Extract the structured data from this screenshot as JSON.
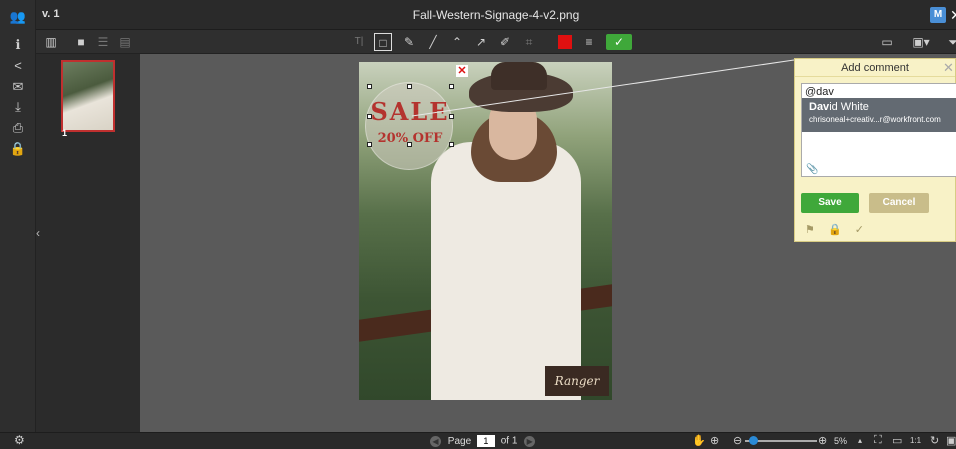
{
  "app": {
    "version": "v. 1",
    "filename": "Fall-Western-Signage-4-v2.png",
    "user_initial": "M"
  },
  "left_rail": [
    {
      "name": "users-icon",
      "glyph": "👥"
    },
    {
      "name": "info-icon",
      "glyph": "ℹ"
    },
    {
      "name": "share-icon",
      "glyph": "<"
    },
    {
      "name": "send-icon",
      "glyph": "✉"
    },
    {
      "name": "download-icon",
      "glyph": "⤓"
    },
    {
      "name": "print-icon",
      "glyph": "⎙"
    },
    {
      "name": "lock-icon",
      "glyph": "🔒"
    }
  ],
  "toolbar": {
    "text_tool": "T|",
    "color_accent": "#e01010",
    "confirm_color": "#3fa83a"
  },
  "thumbnails": [
    {
      "page": "1"
    }
  ],
  "image": {
    "sale_line1": "SALE",
    "sale_line2": "20% OFF",
    "logo_text": "Ranger",
    "delete_glyph": "✕"
  },
  "comment": {
    "title": "Add comment",
    "input_value": "@dav",
    "suggestion_name_bold": "Dav",
    "suggestion_name_rest": "id White",
    "suggestion_email": "chrisoneal+creativ...r@workfront.com",
    "save_label": "Save",
    "cancel_label": "Cancel"
  },
  "footer": {
    "page_label": "Page",
    "page_value": "1",
    "of_label": "of 1",
    "zoom": "5%"
  }
}
